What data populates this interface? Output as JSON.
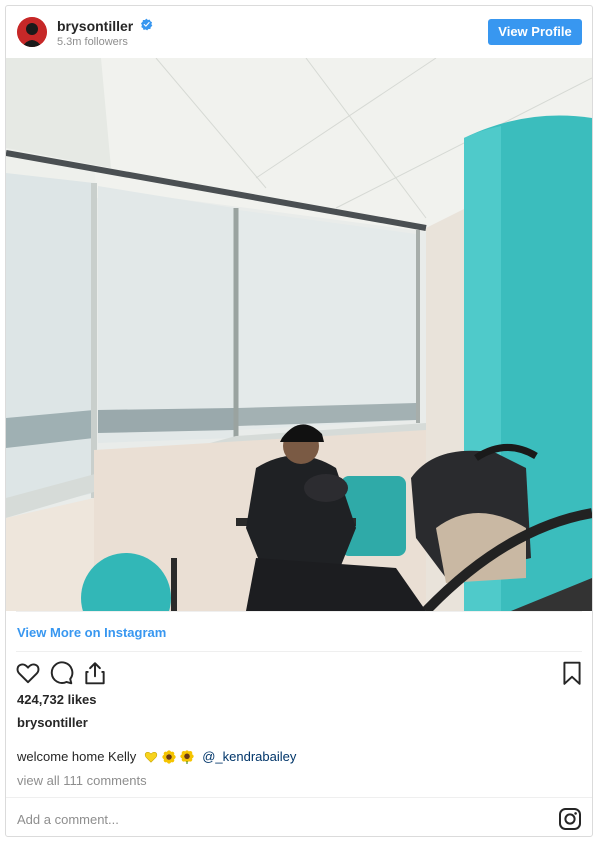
{
  "header": {
    "username": "brysontiller",
    "verified": true,
    "followers": "5.3m followers",
    "view_profile_label": "View Profile"
  },
  "links": {
    "view_more": "View More on Instagram"
  },
  "stats": {
    "likes": "424,732 likes"
  },
  "post": {
    "author": "brysontiller",
    "caption_text": "welcome home Kelly",
    "caption_emojis": [
      "yellow-heart",
      "sunflower",
      "sunflower"
    ],
    "mention": "@_kendrabailey",
    "view_comments": "view all 111 comments"
  },
  "comment": {
    "placeholder": "Add a comment..."
  },
  "icons": [
    "heart-icon",
    "comment-icon",
    "share-icon",
    "bookmark-icon",
    "instagram-icon"
  ],
  "colors": {
    "accent": "#3897f0",
    "mention": "#003569",
    "muted": "#8e8e8e",
    "text": "#262626",
    "teal_pillar": "#3bbdbd"
  }
}
